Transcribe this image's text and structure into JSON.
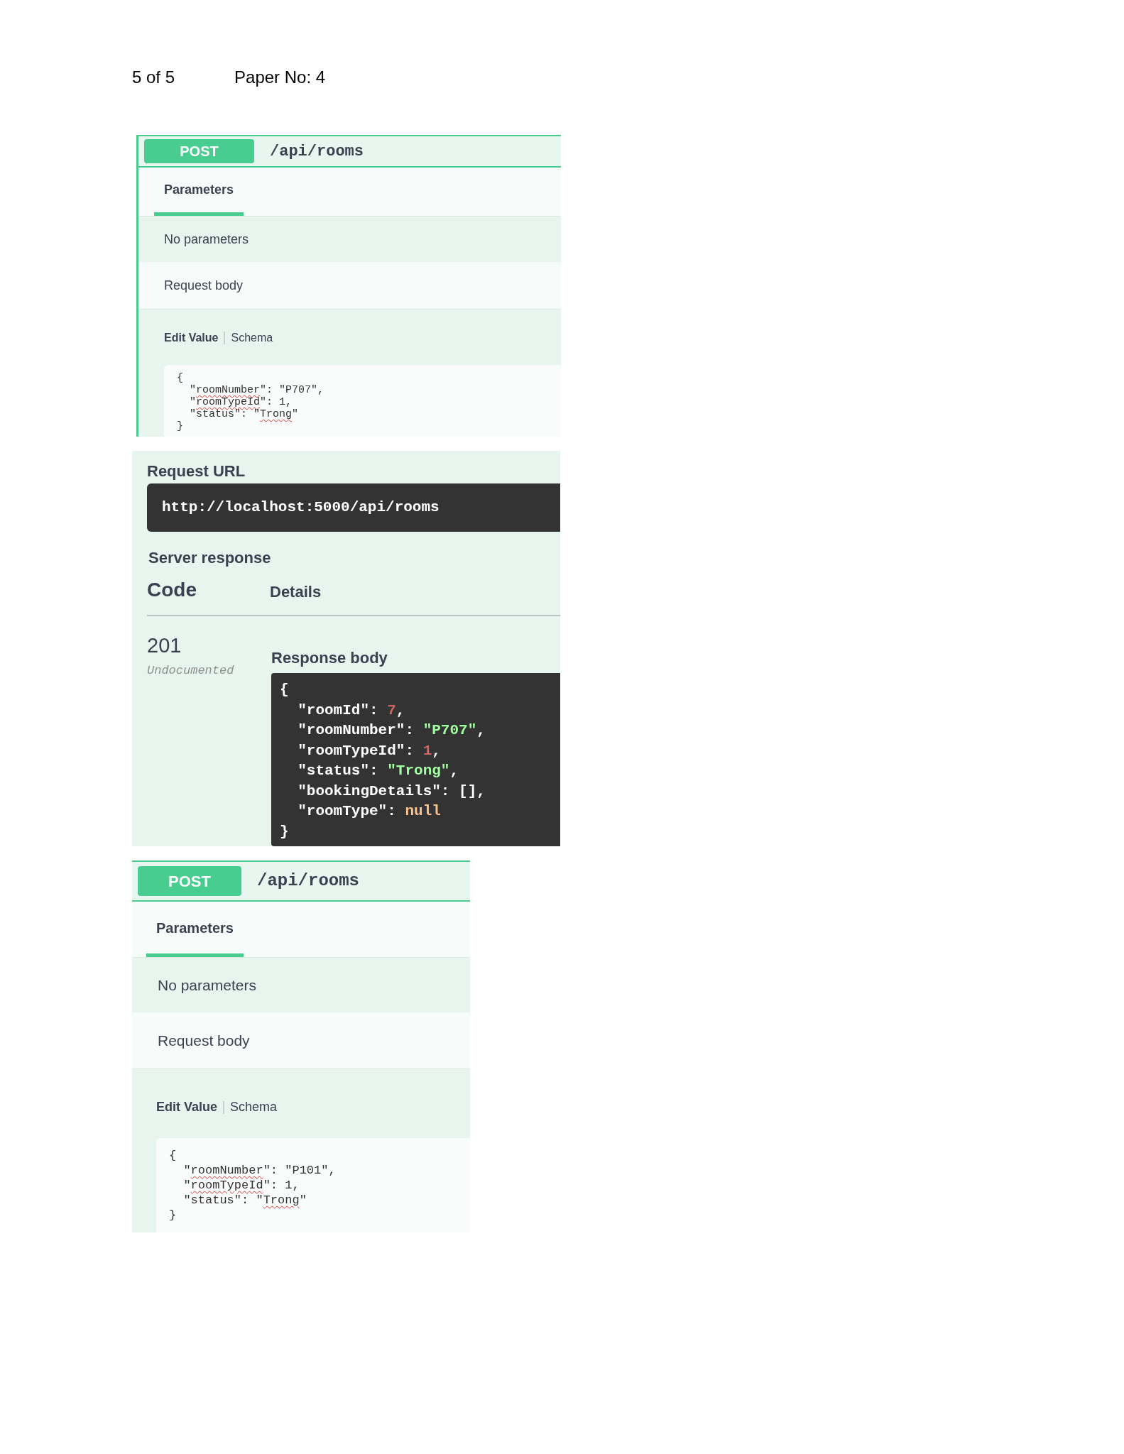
{
  "page_header": {
    "page": "5 of 5",
    "paper": "Paper No: 4"
  },
  "sections": [
    {
      "kind": "operation",
      "method": "POST",
      "path": "/api/rooms",
      "tabs": [
        {
          "label": "Parameters",
          "selected": true
        }
      ],
      "no_params": "No parameters",
      "request_body_label": "Request body",
      "editor_tabs": [
        {
          "label": "Edit Value",
          "selected": true
        },
        {
          "label": "Schema",
          "selected": false
        }
      ],
      "body_lines": [
        [
          {
            "text": "{",
            "kind": "plain"
          }
        ],
        [
          {
            "text": "  \"",
            "kind": "plain"
          },
          {
            "text": "roomNumber",
            "kind": "flagged"
          },
          {
            "text": "\": \"P707\",",
            "kind": "plain"
          }
        ],
        [
          {
            "text": "  \"",
            "kind": "plain"
          },
          {
            "text": "roomTypeId",
            "kind": "flagged"
          },
          {
            "text": "\": 1,",
            "kind": "plain"
          }
        ],
        [
          {
            "text": "  \"status\": \"",
            "kind": "plain"
          },
          {
            "text": "Trong",
            "kind": "flagged"
          },
          {
            "text": "\"",
            "kind": "plain"
          }
        ],
        [
          {
            "text": "}",
            "kind": "plain"
          }
        ]
      ]
    },
    {
      "kind": "response",
      "url_label": "Request URL",
      "url": "http://localhost:5000/api/rooms",
      "server_response_label": "Server response",
      "columns": [
        "Code",
        "Details"
      ],
      "code": "201",
      "code_note": "Undocumented",
      "response_body_label": "Response body",
      "body_lines": [
        [
          {
            "text": "{",
            "kind": "punct"
          }
        ],
        [
          {
            "text": "  \"roomId\": ",
            "kind": "punct"
          },
          {
            "text": "7",
            "kind": "number"
          },
          {
            "text": ",",
            "kind": "punct"
          }
        ],
        [
          {
            "text": "  \"roomNumber\": ",
            "kind": "punct"
          },
          {
            "text": "\"P707\"",
            "kind": "string"
          },
          {
            "text": ",",
            "kind": "punct"
          }
        ],
        [
          {
            "text": "  \"roomTypeId\": ",
            "kind": "punct"
          },
          {
            "text": "1",
            "kind": "number"
          },
          {
            "text": ",",
            "kind": "punct"
          }
        ],
        [
          {
            "text": "  \"status\": ",
            "kind": "punct"
          },
          {
            "text": "\"Trong\"",
            "kind": "string"
          },
          {
            "text": ",",
            "kind": "punct"
          }
        ],
        [
          {
            "text": "  \"bookingDetails\": [],",
            "kind": "punct"
          }
        ],
        [
          {
            "text": "  \"roomType\": ",
            "kind": "punct"
          },
          {
            "text": "null",
            "kind": "null"
          }
        ],
        [
          {
            "text": "}",
            "kind": "punct"
          }
        ]
      ]
    },
    {
      "kind": "operation",
      "method": "POST",
      "path": "/api/rooms",
      "tabs": [
        {
          "label": "Parameters",
          "selected": true
        }
      ],
      "no_params": "No parameters",
      "request_body_label": "Request body",
      "editor_tabs": [
        {
          "label": "Edit Value",
          "selected": true
        },
        {
          "label": "Schema",
          "selected": false
        }
      ],
      "body_lines": [
        [
          {
            "text": "{",
            "kind": "plain"
          }
        ],
        [
          {
            "text": "  \"",
            "kind": "plain"
          },
          {
            "text": "roomNumber",
            "kind": "flagged"
          },
          {
            "text": "\": \"P101\",",
            "kind": "plain"
          }
        ],
        [
          {
            "text": "  \"",
            "kind": "plain"
          },
          {
            "text": "roomTypeId",
            "kind": "flagged"
          },
          {
            "text": "\": 1,",
            "kind": "plain"
          }
        ],
        [
          {
            "text": "  \"status\": \"",
            "kind": "plain"
          },
          {
            "text": "Trong",
            "kind": "flagged"
          },
          {
            "text": "\"",
            "kind": "plain"
          }
        ],
        [
          {
            "text": "}",
            "kind": "plain"
          }
        ]
      ]
    }
  ]
}
